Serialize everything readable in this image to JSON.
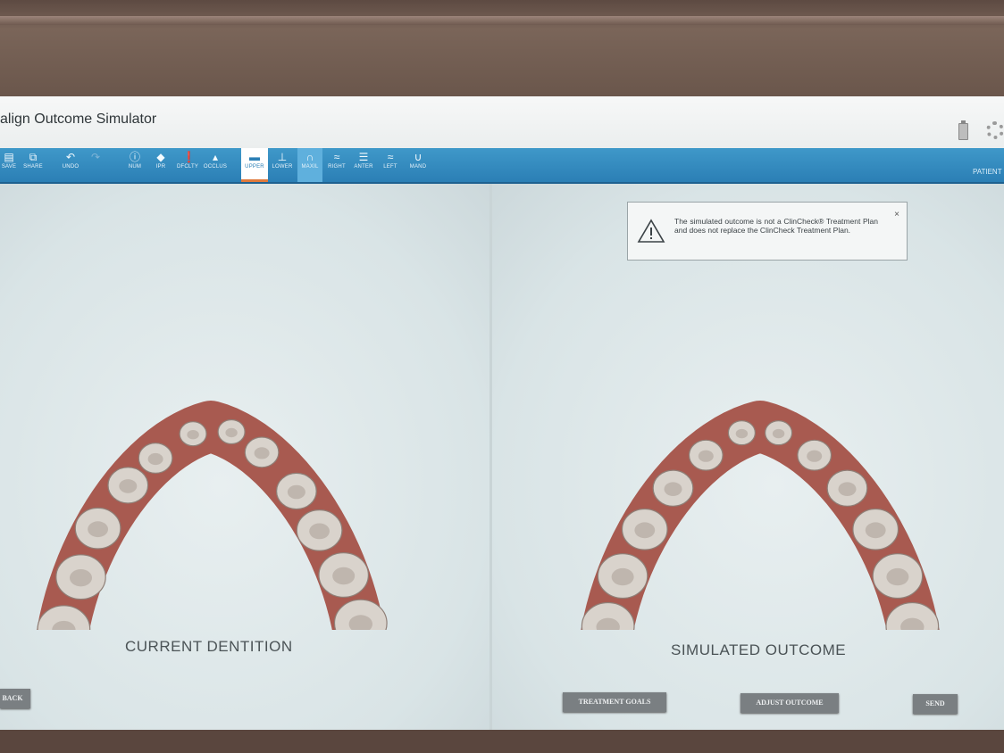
{
  "app": {
    "title": "align Outcome Simulator"
  },
  "toolbar": {
    "items": [
      {
        "label": "SAVE",
        "icon": "save-icon"
      },
      {
        "label": "SHARE",
        "icon": "share-icon"
      },
      {
        "label": "UNDO",
        "icon": "undo-icon"
      },
      {
        "label": "",
        "icon": "redo-icon"
      },
      {
        "label": "NUM",
        "icon": "info-icon"
      },
      {
        "label": "IPR",
        "icon": "diamond-icon"
      },
      {
        "label": "DFCLTY",
        "icon": "alert-icon"
      },
      {
        "label": "OCCLUS",
        "icon": "occlusion-icon"
      },
      {
        "label": "UPPER",
        "icon": "upper-arch-icon"
      },
      {
        "label": "LOWER",
        "icon": "lower-arch-icon"
      },
      {
        "label": "MAXIL",
        "icon": "maxillary-icon"
      },
      {
        "label": "RIGHT",
        "icon": "right-view-icon"
      },
      {
        "label": "ANTER",
        "icon": "anterior-view-icon"
      },
      {
        "label": "LEFT",
        "icon": "left-view-icon"
      },
      {
        "label": "MAND",
        "icon": "mandibular-icon"
      }
    ],
    "patient_label": "PATIENT"
  },
  "disclaimer": {
    "text": "The simulated outcome is not a ClinCheck® Treatment Plan and does not replace the ClinCheck Treatment Plan.",
    "close": "×"
  },
  "left_panel": {
    "caption": "CURRENT DENTITION"
  },
  "right_panel": {
    "caption": "SIMULATED OUTCOME"
  },
  "buttons": {
    "back": "BACK",
    "treatment_goals": "TREATMENT GOALS",
    "adjust_outcome": "ADJUST OUTCOME",
    "send": "SEND"
  },
  "colors": {
    "toolbar": "#2b7fb5",
    "active_underline": "#e07a3c",
    "gum": "#a85a50",
    "tooth": "#d9d3cc"
  }
}
